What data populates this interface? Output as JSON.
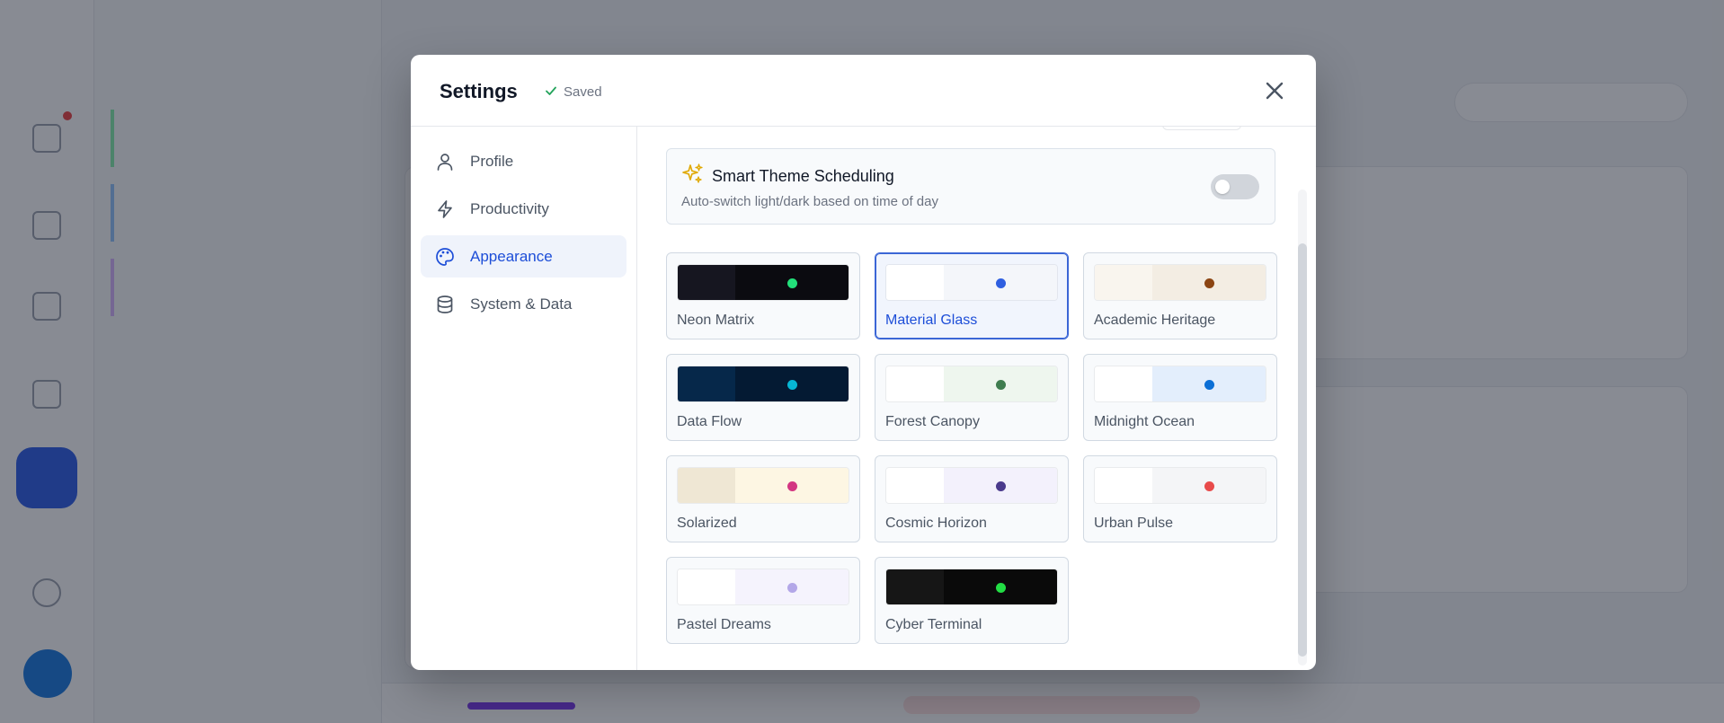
{
  "modal": {
    "title": "Settings",
    "saved_label": "Saved"
  },
  "nav": {
    "items": [
      {
        "label": "Profile",
        "icon": "user-icon",
        "active": false
      },
      {
        "label": "Productivity",
        "icon": "lightning-icon",
        "active": false
      },
      {
        "label": "Appearance",
        "icon": "palette-icon",
        "active": true
      },
      {
        "label": "System & Data",
        "icon": "database-icon",
        "active": false
      }
    ]
  },
  "smart_theme": {
    "title": "Smart Theme Scheduling",
    "subtitle": "Auto-switch light/dark based on time of day",
    "enabled": false
  },
  "themes": [
    {
      "name": "Neon Matrix",
      "a": "#161620",
      "b": "#0b0b10",
      "dot": "#22e07a",
      "selected": false
    },
    {
      "name": "Material Glass",
      "a": "#ffffff",
      "b": "#f4f6fa",
      "dot": "#2f5fe0",
      "selected": true
    },
    {
      "name": "Academic Heritage",
      "a": "#f9f5ee",
      "b": "#f3ede3",
      "dot": "#8b4513",
      "selected": false
    },
    {
      "name": "Data Flow",
      "a": "#06284a",
      "b": "#041a33",
      "dot": "#06b6d4",
      "selected": false
    },
    {
      "name": "Forest Canopy",
      "a": "#ffffff",
      "b": "#eef6ee",
      "dot": "#3f7d4f",
      "selected": false
    },
    {
      "name": "Midnight Ocean",
      "a": "#ffffff",
      "b": "#e3eefc",
      "dot": "#0b6fd6",
      "selected": false
    },
    {
      "name": "Solarized",
      "a": "#efe7d4",
      "b": "#fdf6e3",
      "dot": "#d33682",
      "selected": false
    },
    {
      "name": "Cosmic Horizon",
      "a": "#ffffff",
      "b": "#f3f1fc",
      "dot": "#4a3a8c",
      "selected": false
    },
    {
      "name": "Urban Pulse",
      "a": "#ffffff",
      "b": "#f4f5f7",
      "dot": "#e84b4b",
      "selected": false
    },
    {
      "name": "Pastel Dreams",
      "a": "#ffffff",
      "b": "#f5f3fd",
      "dot": "#b3a7e8",
      "selected": false
    },
    {
      "name": "Cyber Terminal",
      "a": "#161616",
      "b": "#0a0a0a",
      "dot": "#22dd44",
      "selected": false
    }
  ],
  "colors": {
    "accent": "#1d4ed8",
    "toggle_off": "#d1d5db"
  }
}
